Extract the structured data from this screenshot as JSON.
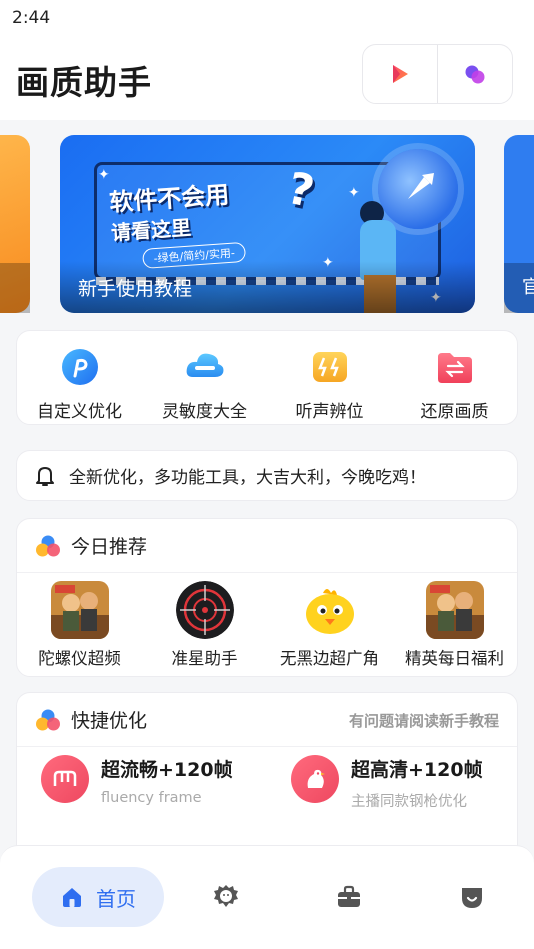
{
  "status_bar": {
    "time": "2:44"
  },
  "header": {
    "title": "画质助手",
    "icons": [
      "play-icon",
      "connect-icon"
    ]
  },
  "banner": {
    "headline1": "软件不会用",
    "question_mark": "?",
    "headline2": "请看这里",
    "tag": "-绿色/简约/实用-",
    "caption": "新手使用教程",
    "next_caption": "官"
  },
  "features": [
    {
      "label": "自定义优化",
      "icon": "custom-p-icon"
    },
    {
      "label": "灵敏度大全",
      "icon": "cloud-sensitivity-icon"
    },
    {
      "label": "听声辨位",
      "icon": "sound-locate-icon"
    },
    {
      "label": "还原画质",
      "icon": "restore-folder-icon"
    }
  ],
  "notice": {
    "text": "全新优化，多功能工具，大吉大利，今晚吃鸡！",
    "icon": "bell-icon"
  },
  "recommend": {
    "title": "今日推荐",
    "items": [
      {
        "label": "陀螺仪超频",
        "icon": "game-poster-icon"
      },
      {
        "label": "准星助手",
        "icon": "crosshair-icon"
      },
      {
        "label": "无黑边超广角",
        "icon": "chick-icon"
      },
      {
        "label": "精英每日福利",
        "icon": "game-poster-icon"
      }
    ]
  },
  "quick": {
    "title": "快捷优化",
    "hint": "有问题请阅读新手教程",
    "items": [
      {
        "title": "超流畅+120帧",
        "subtitle": "fluency frame",
        "icon": "fluency-icon",
        "color": "#f0556a"
      },
      {
        "title": "超高清+120帧",
        "subtitle": "主播同款钢枪优化",
        "icon": "bird-icon",
        "color": "#f0556a"
      }
    ]
  },
  "tabbar": {
    "home_label": "首页",
    "tabs": [
      "home-icon",
      "lion-icon",
      "briefcase-icon",
      "shield-icon"
    ],
    "accent": "#2f6ef0"
  }
}
